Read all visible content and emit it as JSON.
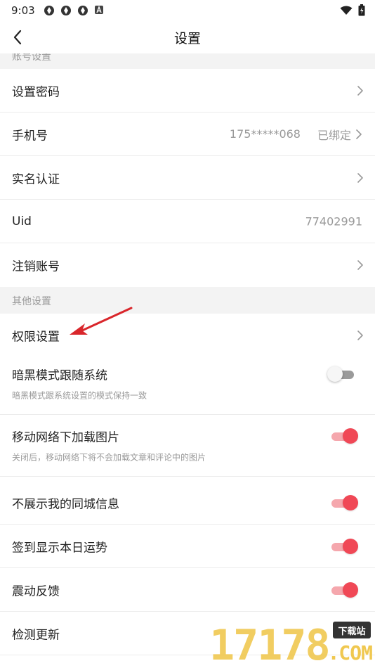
{
  "status_bar": {
    "time": "9:03"
  },
  "nav": {
    "title": "设置"
  },
  "account_section": {
    "header": "账号设置"
  },
  "account_rows": [
    {
      "label": "设置密码"
    },
    {
      "label": "手机号",
      "phone": "175*****068",
      "status": "已绑定"
    },
    {
      "label": "实名认证"
    },
    {
      "label": "Uid",
      "value": "77402991"
    },
    {
      "label": "注销账号"
    }
  ],
  "other_section": {
    "header": "其他设置"
  },
  "other_rows": [
    {
      "label": "权限设置"
    },
    {
      "label": "暗黑模式跟随系统",
      "desc": "暗黑模式跟系统设置的模式保持一致",
      "toggle": "off"
    },
    {
      "label": "移动网络下加载图片",
      "desc": "关闭后，移动网络下将不会加载文章和评论中的图片",
      "toggle": "on"
    },
    {
      "label": "不展示我的同城信息",
      "toggle": "on"
    },
    {
      "label": "签到显示本日运势",
      "toggle": "on"
    },
    {
      "label": "震动反馈",
      "toggle": "on"
    },
    {
      "label": "检测更新"
    }
  ],
  "colors": {
    "accent": "#f04856",
    "accent_light": "#f5a7ad",
    "annotation_arrow": "#d9262b",
    "section_bg": "#f3f3f3"
  },
  "watermark": {
    "digits": "17178",
    "badge": "下载站",
    "suffix": ".COM"
  }
}
